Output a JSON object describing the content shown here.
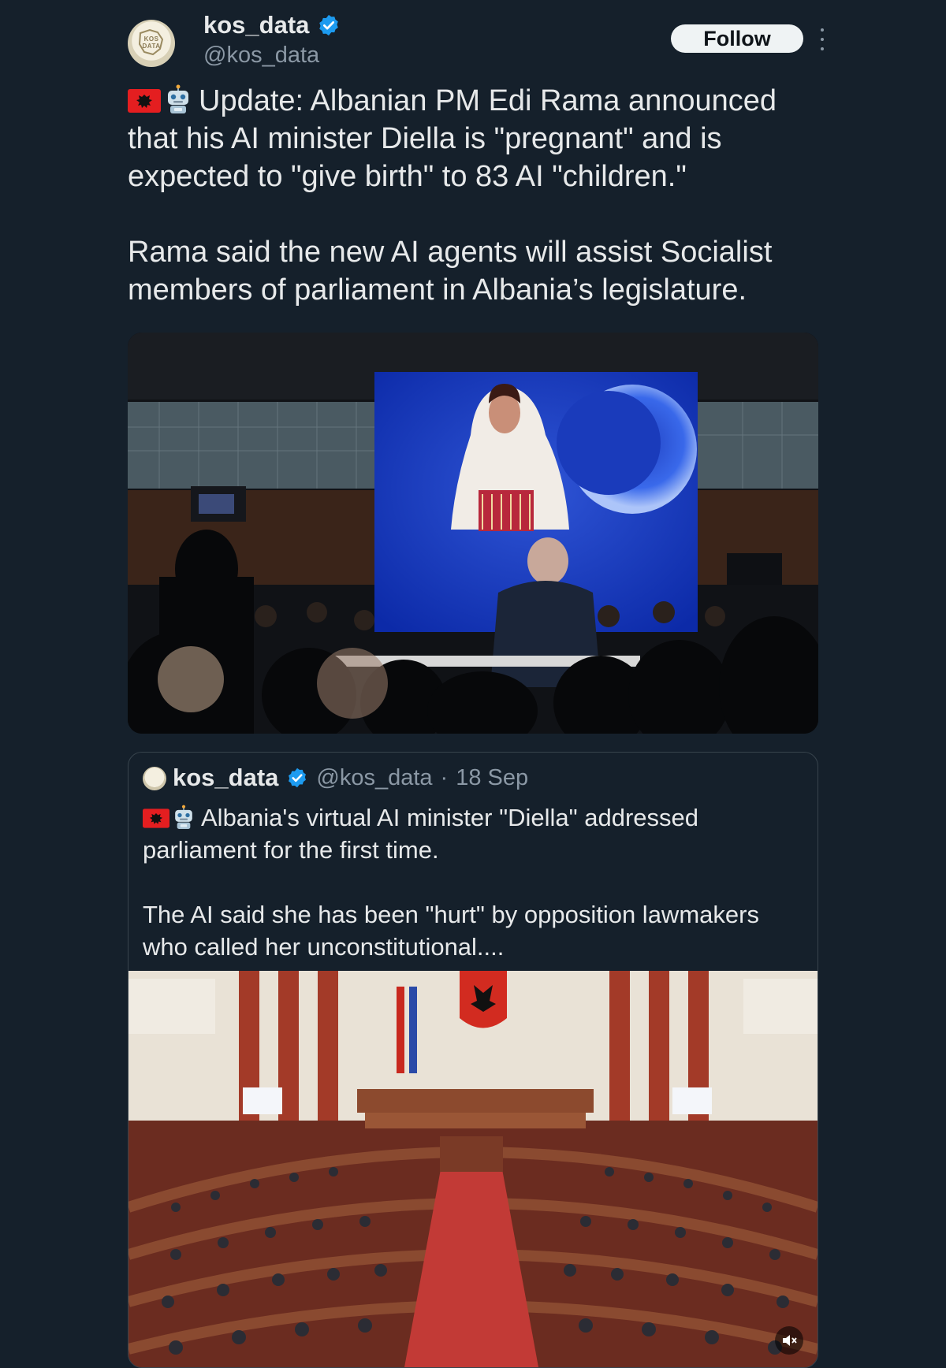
{
  "author": {
    "display_name": "kos_data",
    "handle": "@kos_data",
    "avatar_icon": "kos-data-logo-icon"
  },
  "follow_label": "Follow",
  "tweet": {
    "paragraph1": "Update: Albanian PM Edi Rama announced that his AI minister Diella is \"pregnant\" and is expected to \"give birth\" to 83 AI \"children.\"",
    "paragraph2": "Rama said the new AI agents will assist Socialist members of parliament in Albania’s legislature.",
    "emojis": [
      "albania-flag-icon",
      "robot-icon"
    ]
  },
  "media1": {
    "description_icon": "photo-ai-minister-screen"
  },
  "quoted": {
    "display_name": "kos_data",
    "handle": "@kos_data",
    "separator": "·",
    "date": "18 Sep",
    "paragraph1": "Albania's virtual AI minister \"Diella\" addressed parliament for the first time.",
    "paragraph2": "The AI said she has been \"hurt\" by opposition lawmakers who called her unconstitutional....",
    "media_icon": "video-parliament-chamber"
  },
  "colors": {
    "background": "#15202b",
    "text": "#e7e9ea",
    "secondary_text": "#8b98a5",
    "verified_blue": "#1d9bf0",
    "border": "#38444d"
  }
}
